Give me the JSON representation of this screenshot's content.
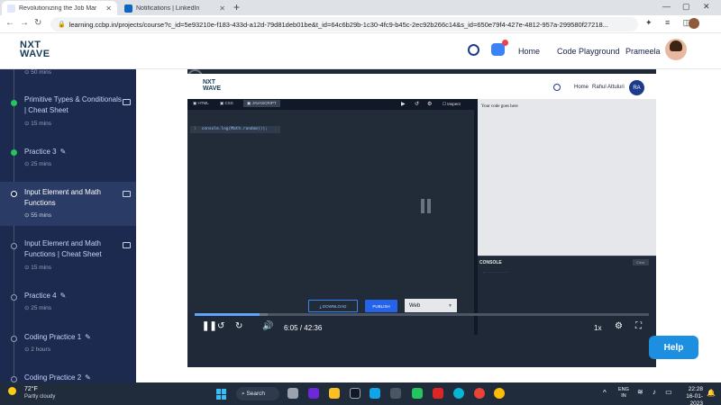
{
  "browser": {
    "tabs": [
      {
        "label": "Revolutionizing the Job Mar",
        "active": true
      },
      {
        "label": "Notifications | LinkedIn",
        "active": false
      }
    ],
    "url": "learning.ccbp.in/projects/course?c_id=5e93210e-f183-433d-a12d-79d81deb01be&t_id=64c6b29b-1c30-4fc9-b45c-2ec92b266c14&s_id=650e79f4-427e-4812-957a-299580f27218..."
  },
  "header": {
    "logo_line1": "NXT",
    "logo_line2": "WAVE",
    "nav": [
      "Home",
      "Code Playground"
    ],
    "user_name": "Prameela"
  },
  "sidebar": {
    "top_duration": "50 mins",
    "items": [
      {
        "title": "Primitive Types & Conditionals | Cheat Sheet",
        "duration": "15 mins",
        "status": "done",
        "kind": "doc"
      },
      {
        "title": "Practice 3",
        "duration": "25 mins",
        "status": "done",
        "kind": "practice"
      },
      {
        "title": "Input Element and Math Functions",
        "duration": "55 mins",
        "status": "current",
        "kind": "doc"
      },
      {
        "title": "Input Element and Math Functions | Cheat Sheet",
        "duration": "15 mins",
        "status": "pending",
        "kind": "doc"
      },
      {
        "title": "Practice 4",
        "duration": "25 mins",
        "status": "pending",
        "kind": "practice"
      },
      {
        "title": "Coding Practice 1",
        "duration": "2 hours",
        "status": "pending",
        "kind": "practice"
      },
      {
        "title": "Coding Practice 2",
        "duration": "",
        "status": "pending",
        "kind": "practice"
      }
    ]
  },
  "video": {
    "ide": {
      "logo_line1": "NXT",
      "logo_line2": "WAVE",
      "home": "Home",
      "user": "Rahul Attuluri",
      "avatar": "RA",
      "tabs": [
        "HTML",
        "CSS",
        "JAVASCRIPT"
      ],
      "inspect": "Inspect",
      "code_line_no": "1",
      "code": "console.log(Math.random());",
      "output_text": "Your code goes here",
      "console_label": "CONSOLE",
      "clear_label": "Clear",
      "download": "DOWNLOAD",
      "publish": "PUBLISH",
      "mode": "Web"
    },
    "replay_seconds": "10",
    "current_time": "6:05",
    "duration": "42:36",
    "time_separator": "/",
    "progress": 0.143,
    "buffered": 0.16,
    "speed": "1x"
  },
  "help_label": "Help",
  "taskbar": {
    "temperature": "72°F",
    "weather": "Partly cloudy",
    "search": "Search",
    "lang_line1": "ENG",
    "lang_line2": "IN",
    "time": "22:28",
    "date": "16-01-2023"
  },
  "colors": {
    "sidebar_bg": "#1b2a4e",
    "accent_blue": "#1d8fe0",
    "progress": "#60a5fa",
    "done_green": "#22c55e"
  }
}
